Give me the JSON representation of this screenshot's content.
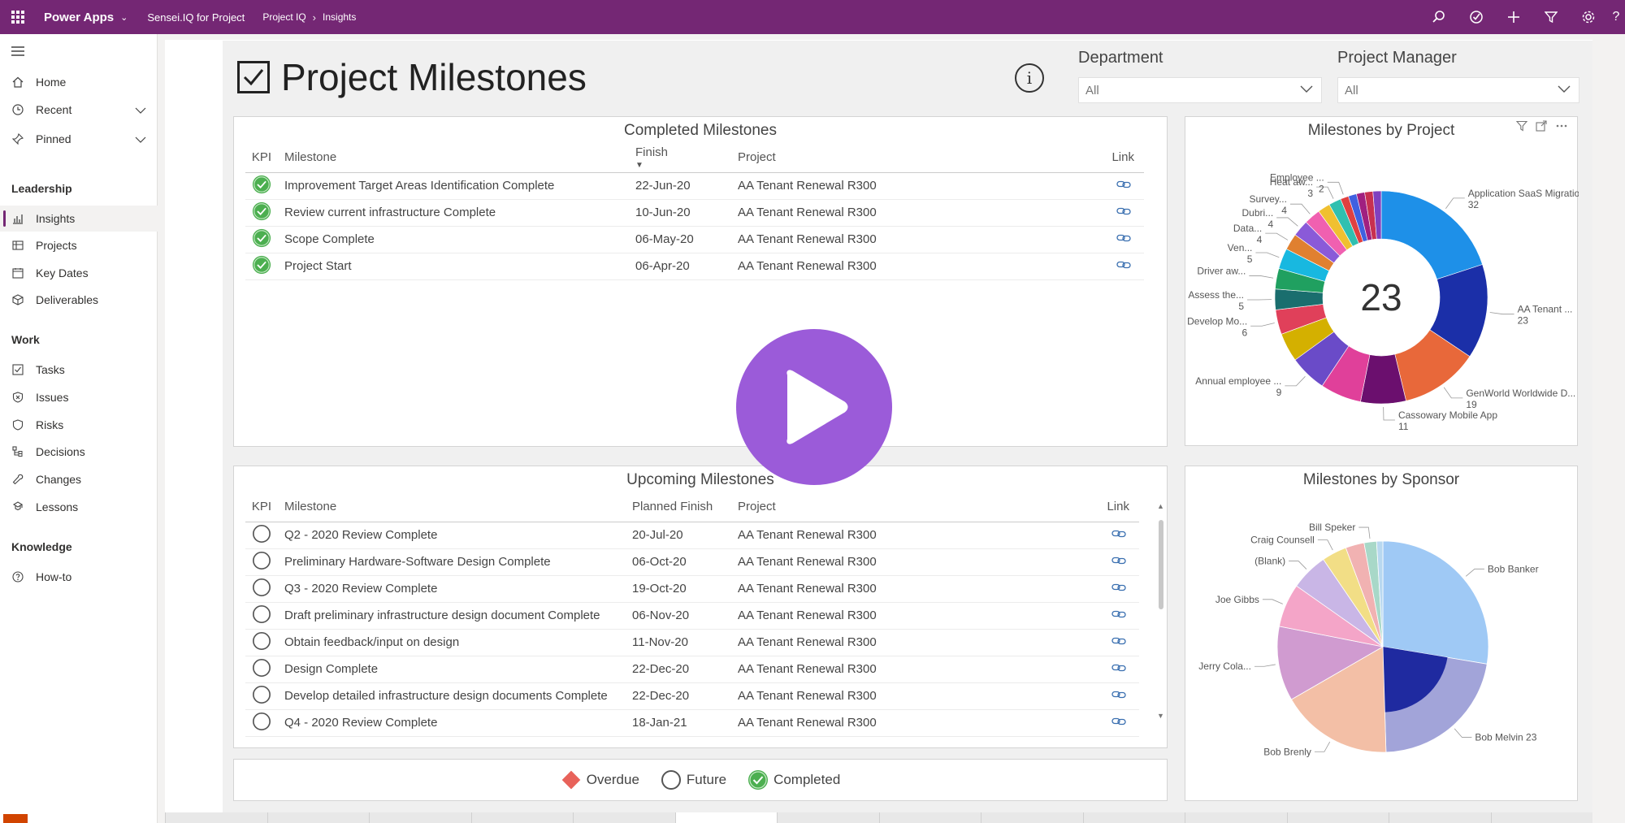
{
  "topbar": {
    "app_name": "Power Apps",
    "environment": "Sensei.IQ for Project",
    "breadcrumb": [
      "Project IQ",
      "Insights"
    ]
  },
  "sidebar": {
    "items": [
      {
        "label": "Home",
        "icon": "home-icon"
      },
      {
        "label": "Recent",
        "icon": "clock-icon"
      },
      {
        "label": "Pinned",
        "icon": "pin-icon"
      }
    ],
    "sections": [
      {
        "heading": "Leadership",
        "items": [
          {
            "label": "Insights",
            "icon": "chart-icon",
            "active": true
          },
          {
            "label": "Projects",
            "icon": "projects-icon"
          },
          {
            "label": "Key Dates",
            "icon": "calendar-icon"
          },
          {
            "label": "Deliverables",
            "icon": "box-icon"
          }
        ]
      },
      {
        "heading": "Work",
        "items": [
          {
            "label": "Tasks",
            "icon": "task-icon"
          },
          {
            "label": "Issues",
            "icon": "issue-icon"
          },
          {
            "label": "Risks",
            "icon": "shield-icon"
          },
          {
            "label": "Decisions",
            "icon": "decision-icon"
          },
          {
            "label": "Changes",
            "icon": "wrench-icon"
          },
          {
            "label": "Lessons",
            "icon": "lessons-icon"
          }
        ]
      },
      {
        "heading": "Knowledge",
        "items": [
          {
            "label": "How-to",
            "icon": "help-icon"
          }
        ]
      }
    ]
  },
  "page": {
    "title": "Project Milestones",
    "info_icon": "i"
  },
  "filters": {
    "department": {
      "label": "Department",
      "value": "All"
    },
    "project_manager": {
      "label": "Project Manager",
      "value": "All"
    }
  },
  "completed": {
    "title": "Completed Milestones",
    "columns": {
      "kpi": "KPI",
      "milestone": "Milestone",
      "finish": "Finish",
      "project": "Project",
      "link": "Link"
    },
    "rows": [
      {
        "milestone": "Improvement Target Areas Identification Complete",
        "finish": "22-Jun-20",
        "project": "AA Tenant Renewal R300"
      },
      {
        "milestone": "Review current infrastructure Complete",
        "finish": "10-Jun-20",
        "project": "AA Tenant Renewal R300"
      },
      {
        "milestone": "Scope Complete",
        "finish": "06-May-20",
        "project": "AA Tenant Renewal R300"
      },
      {
        "milestone": "Project Start",
        "finish": "06-Apr-20",
        "project": "AA Tenant Renewal R300"
      }
    ]
  },
  "upcoming": {
    "title": "Upcoming Milestones",
    "columns": {
      "kpi": "KPI",
      "milestone": "Milestone",
      "finish": "Planned Finish",
      "project": "Project",
      "link": "Link"
    },
    "rows": [
      {
        "milestone": "Q2 - 2020 Review Complete",
        "finish": "20-Jul-20",
        "project": "AA Tenant Renewal R300"
      },
      {
        "milestone": "Preliminary Hardware-Software Design Complete",
        "finish": "06-Oct-20",
        "project": "AA Tenant Renewal R300"
      },
      {
        "milestone": "Q3 - 2020 Review Complete",
        "finish": "19-Oct-20",
        "project": "AA Tenant Renewal R300"
      },
      {
        "milestone": "Draft preliminary infrastructure design document Complete",
        "finish": "06-Nov-20",
        "project": "AA Tenant Renewal R300"
      },
      {
        "milestone": "Obtain feedback/input on design",
        "finish": "11-Nov-20",
        "project": "AA Tenant Renewal R300"
      },
      {
        "milestone": "Design Complete",
        "finish": "22-Dec-20",
        "project": "AA Tenant Renewal R300"
      },
      {
        "milestone": "Develop detailed infrastructure design documents Complete",
        "finish": "22-Dec-20",
        "project": "AA Tenant Renewal R300"
      },
      {
        "milestone": "Q4 - 2020 Review Complete",
        "finish": "18-Jan-21",
        "project": "AA Tenant Renewal R300"
      }
    ]
  },
  "legend": {
    "items": [
      {
        "label": "Overdue",
        "color": "#e8625a"
      },
      {
        "label": "Future",
        "color": "#555555"
      },
      {
        "label": "Completed",
        "color": "#4caf50"
      }
    ]
  },
  "chart_data": [
    {
      "type": "pie",
      "title": "Milestones by Project",
      "center_label": "23",
      "slices": [
        {
          "label": "Application SaaS Migration",
          "value": 32,
          "color": "#1e90e8"
        },
        {
          "label": "AA Tenant ...",
          "value": 23,
          "color": "#1b2fa8"
        },
        {
          "label": "GenWorld Worldwide D...",
          "value": 19,
          "color": "#e8683a"
        },
        {
          "label": "Cassowary Mobile App",
          "value": 11,
          "color": "#6b0f6e"
        },
        {
          "label": "",
          "value": 10,
          "color": "#e0409a"
        },
        {
          "label": "Annual employee ...",
          "value": 9,
          "color": "#6a4bc8"
        },
        {
          "label": "",
          "value": 7,
          "color": "#d4b000"
        },
        {
          "label": "Develop Mo...",
          "value": 6,
          "color": "#e0405a"
        },
        {
          "label": "Assess the...",
          "value": 5,
          "color": "#1a6e6e"
        },
        {
          "label": "Driver aw...",
          "value": 5,
          "color": "#20a060"
        },
        {
          "label": "Ven...",
          "value": 5,
          "color": "#18b8e0"
        },
        {
          "label": "Data...",
          "value": 4,
          "color": "#e08030"
        },
        {
          "label": "Dubri...",
          "value": 4,
          "color": "#8a5ad8"
        },
        {
          "label": "Survey...",
          "value": 4,
          "color": "#f060b0"
        },
        {
          "label": "",
          "value": 3,
          "color": "#f0c030"
        },
        {
          "label": "Heat aw...",
          "value": 3,
          "color": "#30c0b0"
        },
        {
          "label": "Employee ...",
          "value": 2,
          "color": "#e04040"
        },
        {
          "label": "",
          "value": 2,
          "color": "#4060e0"
        },
        {
          "label": "",
          "value": 2,
          "color": "#a02080"
        },
        {
          "label": "",
          "value": 2,
          "color": "#c83050"
        },
        {
          "label": "",
          "value": 2,
          "color": "#8040c0"
        }
      ],
      "label_values": {
        "Application SaaS Migration": "32",
        "AA Tenant ...": "23",
        "GenWorld Worldwide D...": "19",
        "Cassowary Mobile App": "11",
        "Annual employee ...": "9",
        "Develop Mo...": "6",
        "Assess the...": "5",
        "Driver aw...": "",
        "Ven...": "5",
        "Data...": "4",
        "Dubri...": "4",
        "Survey...": "4",
        "Heat aw...": "3",
        "Employee ...": "2"
      }
    },
    {
      "type": "pie",
      "title": "Milestones by Sponsor",
      "slices": [
        {
          "label": "Bob Banker",
          "value": 29,
          "color": "#9fc9f5"
        },
        {
          "label": "Bob Melvin 23",
          "value": 23,
          "color": "#a2a4d9"
        },
        {
          "label": "Bob Brenly",
          "value": 18,
          "color": "#f3bfa6"
        },
        {
          "label": "Jerry Cola...",
          "value": 12,
          "color": "#d09bd0"
        },
        {
          "label": "Joe Gibbs",
          "value": 7,
          "color": "#f4a5c8"
        },
        {
          "label": "(Blank)",
          "value": 6,
          "color": "#c9b6e6"
        },
        {
          "label": "Craig Counsell",
          "value": 4,
          "color": "#f2de86"
        },
        {
          "label": "",
          "value": 3,
          "color": "#f1b2b2"
        },
        {
          "label": "Bill Speker",
          "value": 2,
          "color": "#a8d8c8"
        },
        {
          "label": "",
          "value": 1,
          "color": "#b8d8f0"
        }
      ],
      "highlight": {
        "label": "Bob Melvin 23",
        "fraction": 0.62,
        "color": "#1f2aa0"
      }
    }
  ],
  "colors": {
    "brand": "#742774",
    "accent_play": "#9b5bd9",
    "completed_kpi": "#4caf50"
  }
}
